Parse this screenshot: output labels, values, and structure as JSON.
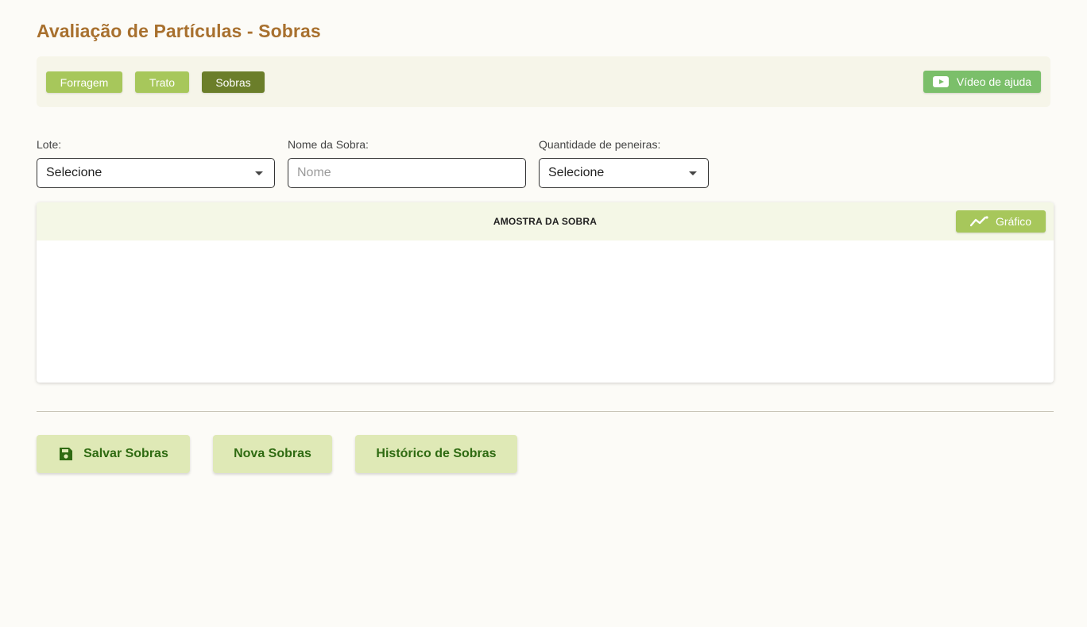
{
  "page": {
    "title": "Avaliação de Partículas - Sobras"
  },
  "tabs": [
    {
      "label": "Forragem",
      "active": false
    },
    {
      "label": "Trato",
      "active": false
    },
    {
      "label": "Sobras",
      "active": true
    }
  ],
  "help": {
    "label": "Vídeo de ajuda",
    "icon": "youtube-play-icon"
  },
  "form": {
    "lote": {
      "label": "Lote:",
      "value": "Selecione"
    },
    "nome": {
      "label": "Nome da Sobra:",
      "placeholder": "Nome",
      "value": ""
    },
    "peneiras": {
      "label": "Quantidade de peneiras:",
      "value": "Selecione"
    }
  },
  "sample_table": {
    "title": "AMOSTRA DA SOBRA",
    "graph_button": "Gráfico",
    "graph_icon": "line-chart-icon"
  },
  "actions": {
    "save": "Salvar Sobras",
    "save_icon": "floppy-disk-icon",
    "new": "Nova Sobras",
    "history": "Histórico de Sobras"
  },
  "colors": {
    "title": "#a8702e",
    "tab_light": "#a7c75b",
    "tab_active": "#6b7e2a",
    "help_button": "#7bbf6a",
    "action_bg": "#dfe9b6",
    "action_text": "#2f6b12"
  }
}
